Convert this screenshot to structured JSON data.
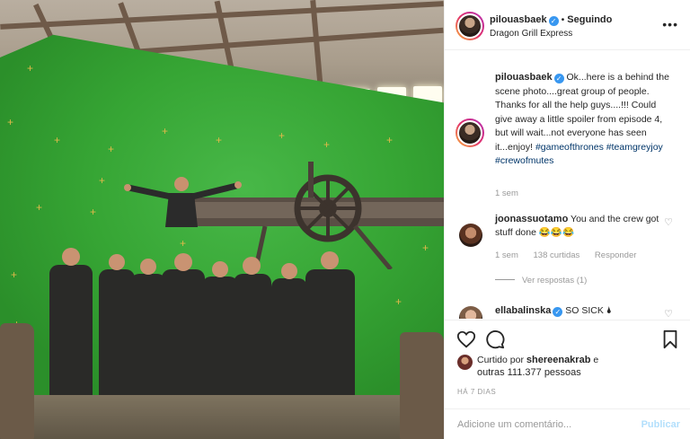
{
  "post": {
    "author": "pilouasbaek",
    "follow_status": "Seguindo",
    "location": "Dragon Grill Express",
    "caption_text": "Ok...here is a behind the scene photo....great group of people. Thanks for all the help guys....!!! Could give away a little spoiler from episode 4, but will wait...not everyone has seen it...enjoy!",
    "hashtags": [
      "#gameofthrones",
      "#teamgreyjoy",
      "#crewofmutes"
    ],
    "caption_age": "1 sem"
  },
  "comments": [
    {
      "author": "joonassuotamo",
      "text": "You and the crew got stuff done 😂😂😂",
      "age": "1 sem",
      "likes": "138 curtidas",
      "reply_label": "Responder",
      "view_replies": "Ver respostas (1)"
    },
    {
      "author": "ellabalinska",
      "text": "SO SICK 🌢"
    }
  ],
  "likes": {
    "prefix": "Curtido por",
    "user": "shereenakrab",
    "connector": "e",
    "others": "outras 111.377 pessoas"
  },
  "timestamp": "HÁ 7 DIAS",
  "add_comment": {
    "placeholder": "Adicione um comentário...",
    "publish_label": "Publicar"
  },
  "icons": {
    "verified": "verified-badge-icon",
    "more": "more-options-icon",
    "like": "heart-icon",
    "comment": "comment-bubble-icon",
    "save": "bookmark-icon"
  },
  "colors": {
    "verified": "#3897f0",
    "hashtag": "#003569",
    "publish_disabled": "#b2dffc",
    "muted": "#999999"
  }
}
